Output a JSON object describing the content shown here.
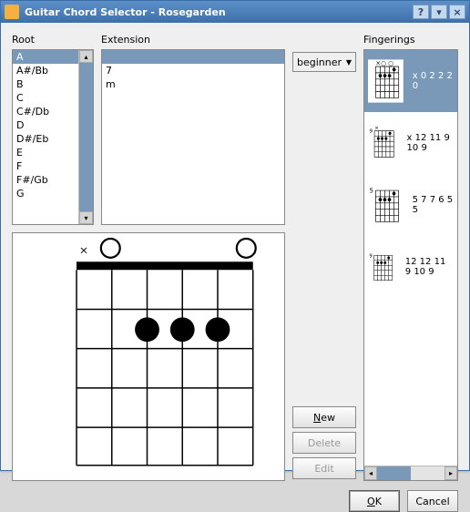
{
  "window": {
    "title": "Guitar Chord Selector - Rosegarden"
  },
  "labels": {
    "root": "Root",
    "extension": "Extension",
    "fingerings": "Fingerings"
  },
  "root": {
    "items": [
      "A",
      "A#/Bb",
      "B",
      "C",
      "C#/Db",
      "D",
      "D#/Eb",
      "E",
      "F",
      "F#/Gb",
      "G"
    ],
    "selected": 0
  },
  "extension": {
    "items": [
      "",
      "7",
      "m"
    ],
    "selected": 0
  },
  "level": {
    "value": "beginner"
  },
  "buttons": {
    "new": "New",
    "delete": "Delete",
    "edit": "Edit",
    "ok": "OK",
    "cancel": "Cancel"
  },
  "fingerings": {
    "items": [
      {
        "label": "x 0 2 2 2 0",
        "pos": "",
        "top": "×○       ○"
      },
      {
        "label": "x 12 11 9 10 9",
        "pos": "9",
        "top": "   ×"
      },
      {
        "label": "5 7 7 6 5 5",
        "pos": "5",
        "top": ""
      },
      {
        "label": "12 12 11 9 10 9",
        "pos": "9",
        "top": ""
      }
    ],
    "selected": 0
  },
  "preview": {
    "top_markers": "×○              ○"
  }
}
